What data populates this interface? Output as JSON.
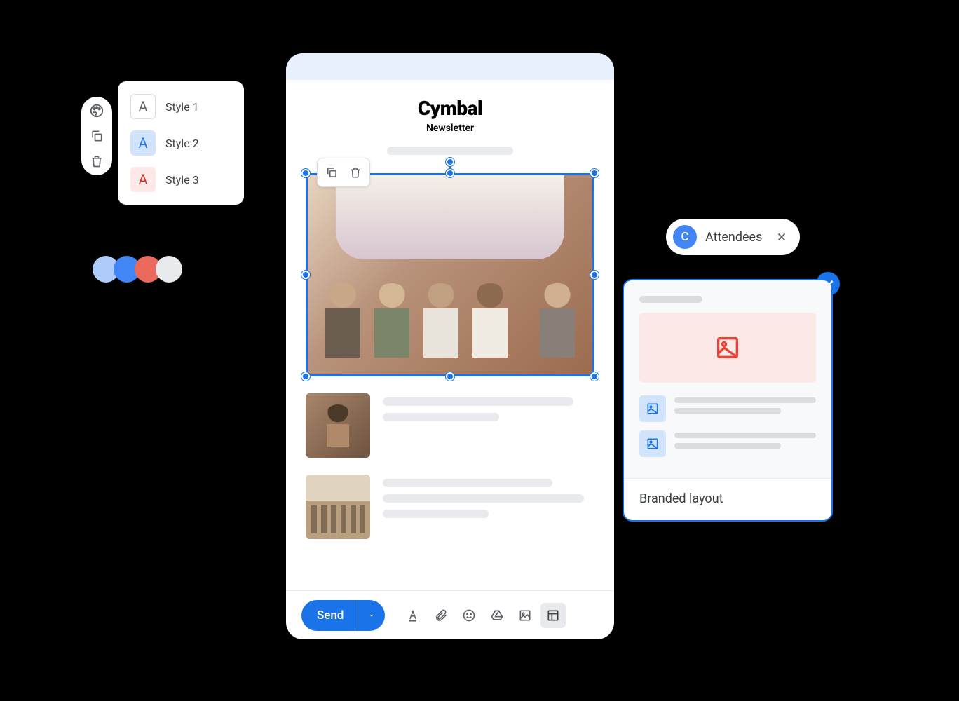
{
  "style_picker": {
    "styles": [
      {
        "label": "Style 1",
        "glyph": "A"
      },
      {
        "label": "Style 2",
        "glyph": "A"
      },
      {
        "label": "Style 3",
        "glyph": "A"
      }
    ]
  },
  "palette": {
    "colors": [
      "#aecbfa",
      "#4285f4",
      "#ea6a5e",
      "#e8eaed"
    ]
  },
  "editor": {
    "brand": "Cymbal",
    "subtitle": "Newsletter",
    "send_label": "Send"
  },
  "chip": {
    "avatar_letter": "C",
    "label": "Attendees"
  },
  "layout_card": {
    "label": "Branded layout"
  }
}
